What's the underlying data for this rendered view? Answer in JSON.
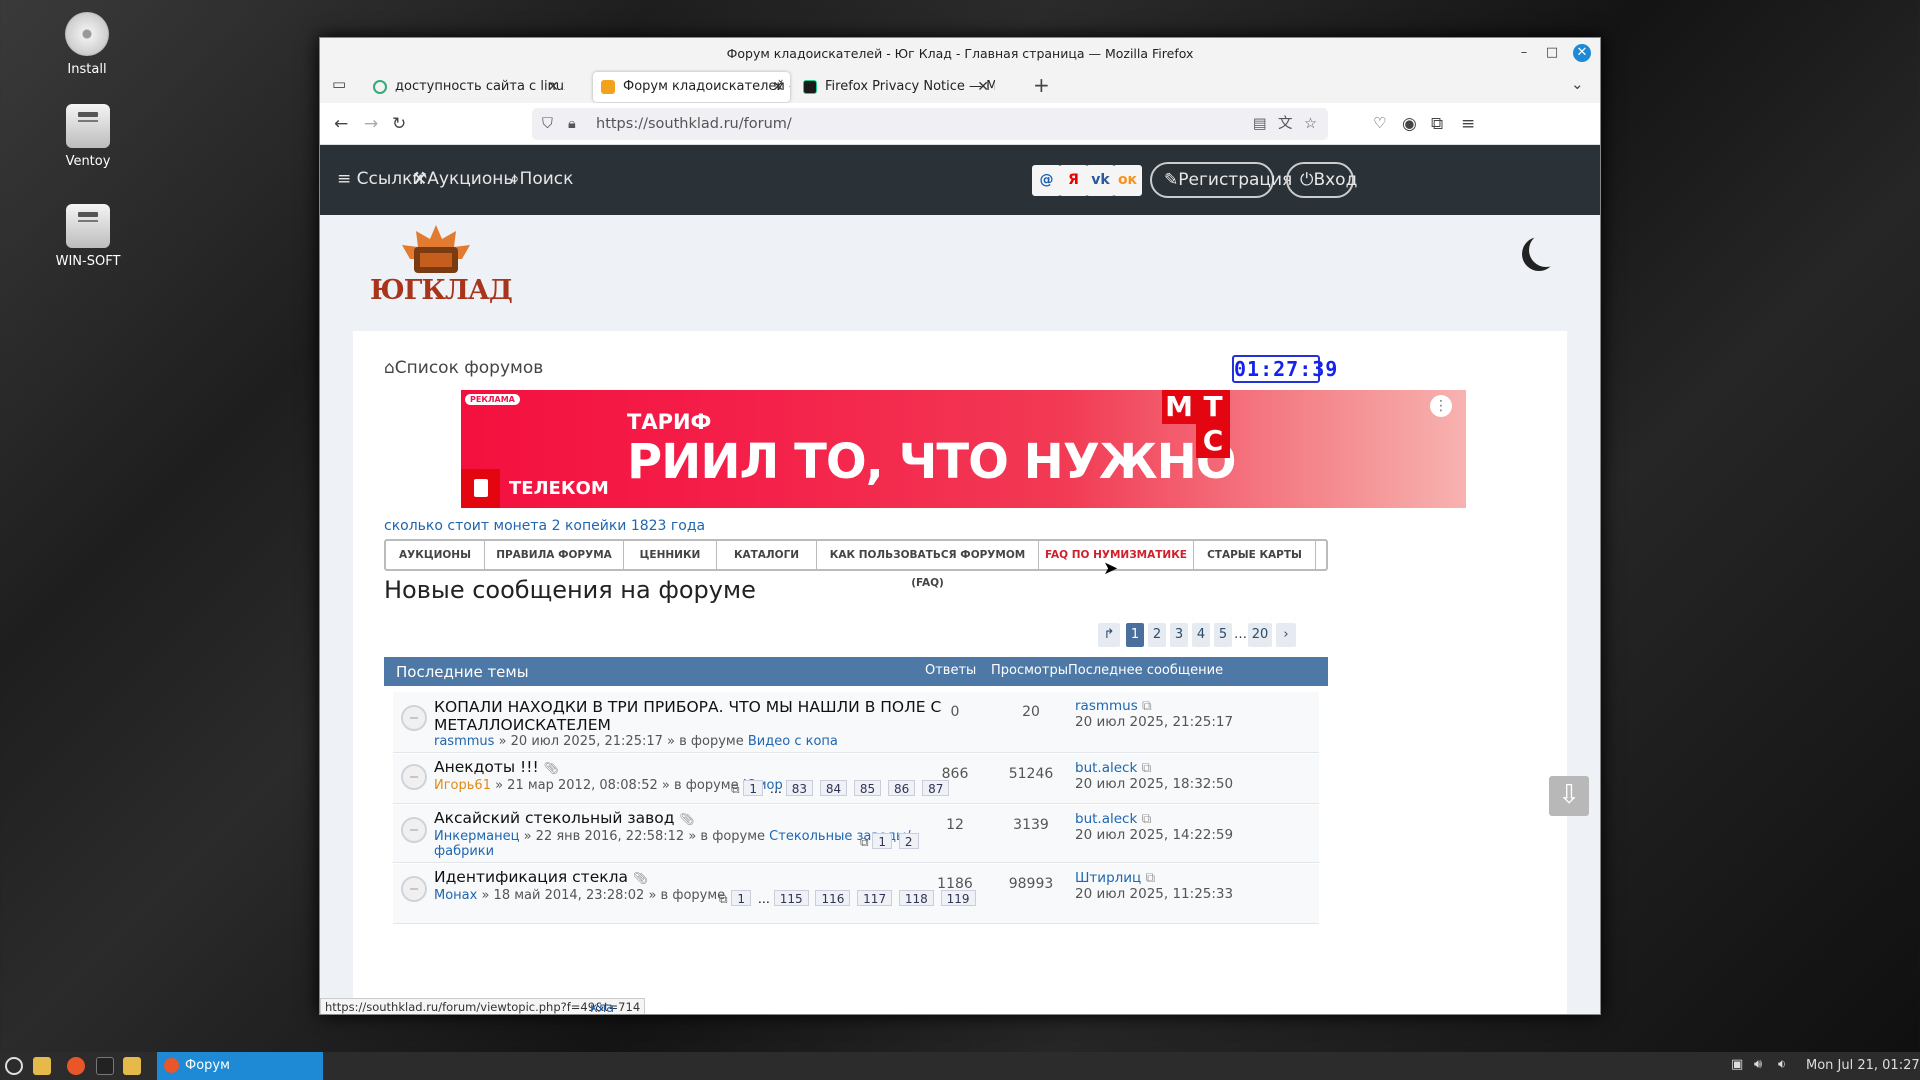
{
  "desktop": {
    "icons": [
      {
        "label": "Install"
      },
      {
        "label": "Ventoy"
      },
      {
        "label": "WIN-SOFT"
      }
    ]
  },
  "window": {
    "title": "Форум кладоискателей - Юг Клад - Главная страница — Mozilla Firefox",
    "tabs": [
      {
        "label": "доступность сайта с linux - "
      },
      {
        "label": "Форум кладоискателей - К"
      },
      {
        "label": "Firefox Privacy Notice — Mc"
      }
    ],
    "new_tab": "+",
    "url": "https://southklad.ru/forum/"
  },
  "site": {
    "nav": {
      "links": "Ссылки",
      "auctions": "Аукционы",
      "search": "Поиск"
    },
    "social": [
      "@",
      "Я",
      "vk",
      "ок"
    ],
    "register": "Регистрация",
    "login": "Вход",
    "logo_text": "ЮГКЛАД",
    "breadcrumb": "Список форумов",
    "clock": "01:27:39",
    "ad": {
      "label": "РЕКЛАМА",
      "line1": "ТАРИФ",
      "line2": "РИИЛ ТО, ЧТО НУЖНО",
      "brand": "ТЕЛЕКОМ",
      "mts": [
        "М",
        "Т",
        "С"
      ]
    },
    "ad_link": "сколько стоит монета 2 копейки 1823 года",
    "menu": [
      "АУКЦИОНЫ",
      "ПРАВИЛА ФОРУМА",
      "ЦЕННИКИ",
      "КАТАЛОГИ",
      "КАК ПОЛЬЗОВАТЬСЯ ФОРУМОМ (FAQ)",
      "FAQ ПО НУМИЗМАТИКЕ",
      "СТАРЫЕ КАРТЫ"
    ],
    "heading": "Новые сообщения на форуме",
    "pagination": {
      "pages": [
        "1",
        "2",
        "3",
        "4",
        "5",
        "…",
        "20"
      ]
    },
    "table": {
      "h_topics": "Последние темы",
      "h_replies": "Ответы",
      "h_views": "Просмотры",
      "h_last": "Последнее сообщение",
      "rows": [
        {
          "title": "КОПАЛИ НАХОДКИ В ТРИ ПРИБОРА. ЧТО МЫ НАШЛИ В ПОЛЕ С",
          "title2": "МЕТАЛЛОИСКАТЕЛЕМ",
          "author": "rasmmus",
          "date": " » 20 июл 2025, 21:25:17 » в форуме ",
          "forum": "Видео с копа",
          "replies": "0",
          "views": "20",
          "last_user": "rasmmus",
          "last_date": "20 июл 2025, 21:25:17"
        },
        {
          "title": "Анекдоты !!!",
          "author": "Игорь61",
          "date": " » 21 мар 2012, 08:08:52 » в форуме ",
          "forum": "Юмор",
          "pages": [
            "1",
            "…",
            "83",
            "84",
            "85",
            "86",
            "87"
          ],
          "replies": "866",
          "views": "51246",
          "last_user": "but.aleck",
          "last_date": "20 июл 2025, 18:32:50"
        },
        {
          "title": "Аксайский стекольный завод",
          "author": "Инкерманец",
          "date": " » 22 янв 2016, 22:58:12 » в форуме ",
          "forum": "Стекольные заводы/",
          "forum2": "фабрики",
          "pages": [
            "1",
            "2"
          ],
          "replies": "12",
          "views": "3139",
          "last_user": "but.aleck",
          "last_date": "20 июл 2025, 14:22:59"
        },
        {
          "title": "Идентификация стекла",
          "author": "Монах",
          "date": " » 18 май 2014, 23:28:02 » в форуме",
          "pages": [
            "1",
            "…",
            "115",
            "116",
            "117",
            "118",
            "119"
          ],
          "replies": "1186",
          "views": "98993",
          "last_user": "Штирлиц",
          "last_date": "20 июл 2025, 11:25:33"
        }
      ]
    }
  },
  "status_url": "https://southklad.ru/forum/viewtopic.php?f=49&t=714",
  "status_tail": "кла",
  "taskbar": {
    "task": "Форум кладоискат...",
    "clock": "Mon Jul 21, 01:27"
  },
  "colors": {
    "accent": "#4e79a6",
    "nav_bg": "#2a3137",
    "link": "#2066b0"
  }
}
